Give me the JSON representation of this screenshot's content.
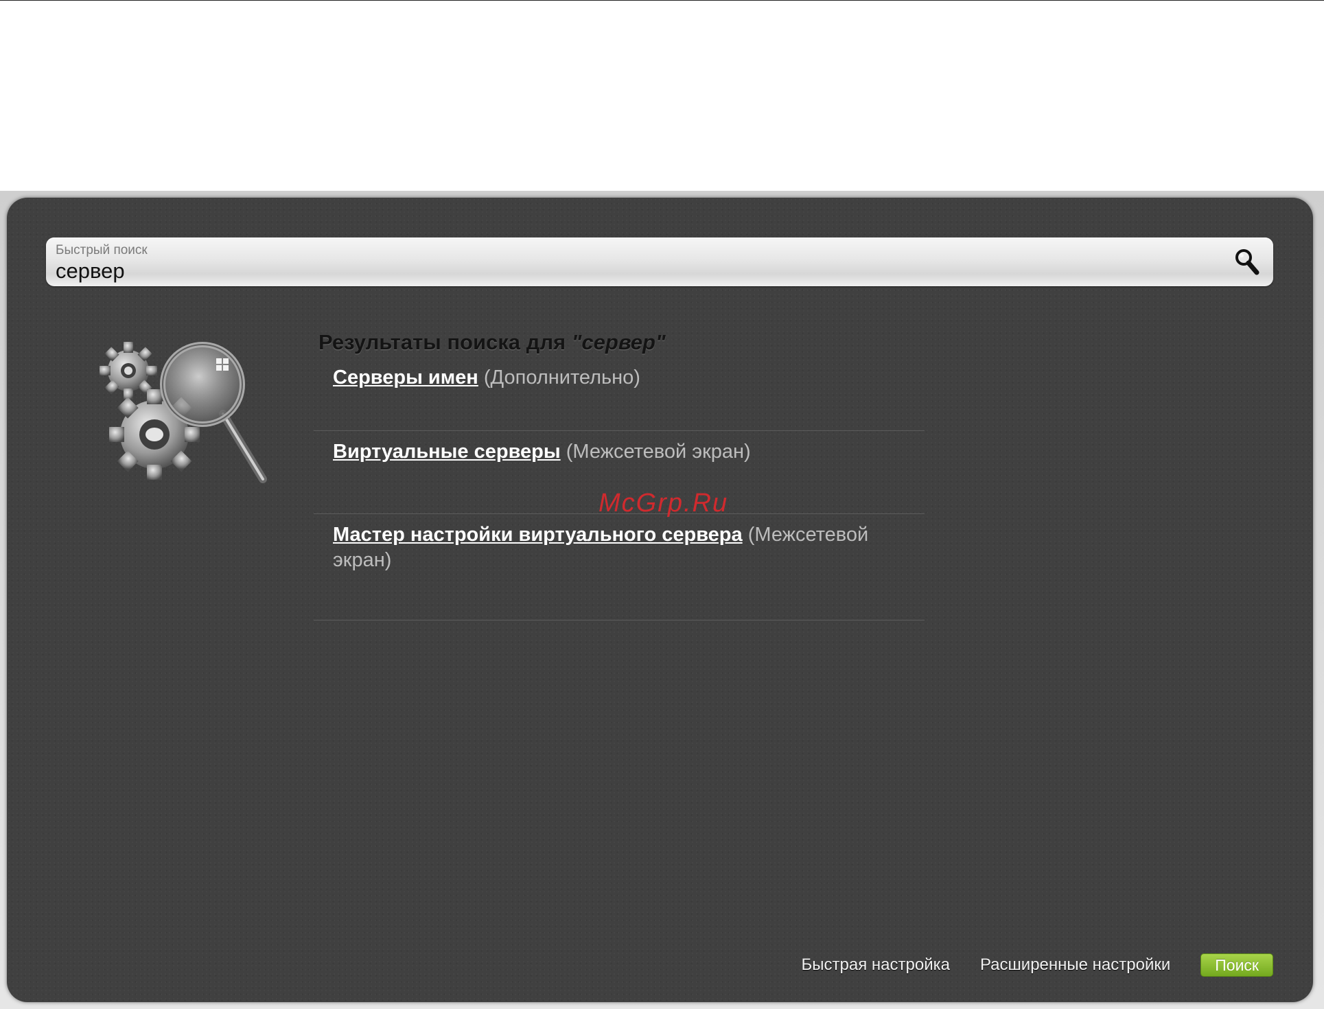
{
  "search": {
    "label": "Быстрый поиск",
    "value": "сервер",
    "icon": "search-icon"
  },
  "results": {
    "title_prefix": "Результаты поиска для ",
    "title_query": "\"сервер\"",
    "items": [
      {
        "link": "Серверы имен",
        "section": "(Дополнительно)"
      },
      {
        "link": "Виртуальные серверы",
        "section": "(Межсетевой экран)"
      },
      {
        "link": "Мастер настройки виртуального сервера",
        "section": "(Межсетевой экран)"
      }
    ]
  },
  "watermark": "McGrp.Ru",
  "footer": {
    "quick_setup": "Быстрая настройка",
    "advanced_settings": "Расширенные настройки",
    "search_button": "Поиск"
  },
  "colors": {
    "panel": "#404040",
    "accent_green": "#8bc034",
    "watermark_red": "#e0282d"
  }
}
